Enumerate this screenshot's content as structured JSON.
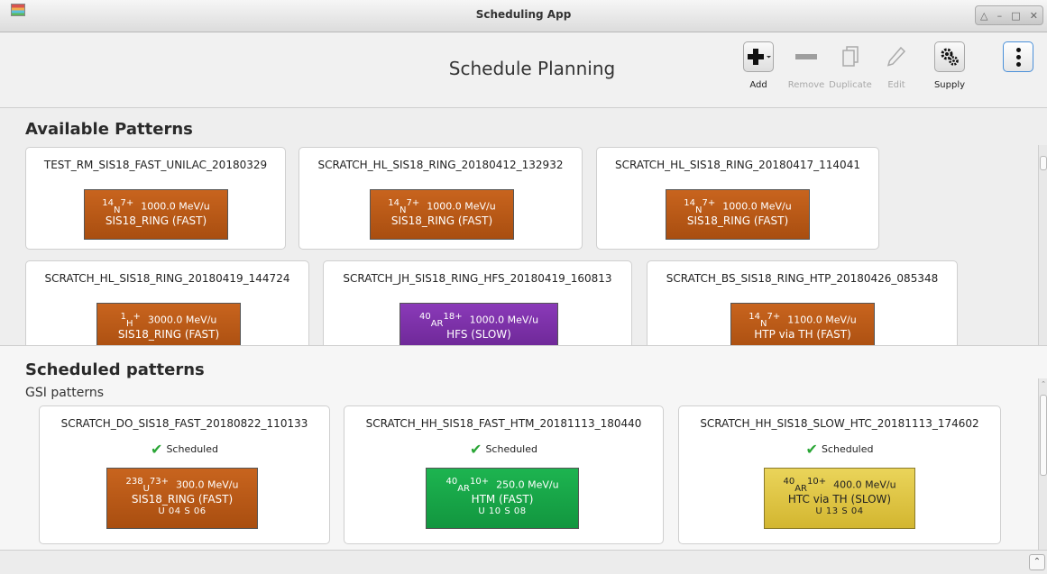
{
  "window": {
    "title": "Scheduling App"
  },
  "toolbar": {
    "page_title": "Schedule Planning",
    "buttons": [
      {
        "label": "Add",
        "icon": "plus-icon",
        "enabled": true
      },
      {
        "label": "Remove",
        "icon": "minus-icon",
        "enabled": false
      },
      {
        "label": "Duplicate",
        "icon": "duplicate-icon",
        "enabled": false
      },
      {
        "label": "Edit",
        "icon": "pencil-icon",
        "enabled": false
      },
      {
        "label": "Supply",
        "icon": "gears-icon",
        "enabled": true
      }
    ]
  },
  "available": {
    "title": "Available Patterns",
    "patterns": [
      {
        "name": "TEST_RM_SIS18_FAST_UNILAC_20180329",
        "mass": "14",
        "ion": "N",
        "charge": "7+",
        "energy": "1000.0 MeV/u",
        "target": "SIS18_RING (FAST)",
        "color": "#b85a18"
      },
      {
        "name": "SCRATCH_HL_SIS18_RING_20180412_132932",
        "mass": "14",
        "ion": "N",
        "charge": "7+",
        "energy": "1000.0 MeV/u",
        "target": "SIS18_RING (FAST)",
        "color": "#b85a18"
      },
      {
        "name": "SCRATCH_HL_SIS18_RING_20180417_114041",
        "mass": "14",
        "ion": "N",
        "charge": "7+",
        "energy": "1000.0 MeV/u",
        "target": "SIS18_RING (FAST)",
        "color": "#b85a18"
      },
      {
        "name": "SCRATCH_HL_SIS18_RING_20180419_144724",
        "mass": "1",
        "ion": "H",
        "charge": "+",
        "energy": "3000.0 MeV/u",
        "target": "SIS18_RING (FAST)",
        "color": "#b85a18"
      },
      {
        "name": "SCRATCH_JH_SIS18_RING_HFS_20180419_160813",
        "mass": "40",
        "ion": "AR",
        "charge": "18+",
        "energy": "1000.0 MeV/u",
        "target": "HFS (SLOW)",
        "color": "#7a2fa6"
      },
      {
        "name": "SCRATCH_BS_SIS18_RING_HTP_20180426_085348",
        "mass": "14",
        "ion": "N",
        "charge": "7+",
        "energy": "1100.0 MeV/u",
        "target": "HTP via TH (FAST)",
        "color": "#b85a18"
      }
    ]
  },
  "scheduled": {
    "title": "Scheduled patterns",
    "group": "GSI patterns",
    "status_label": "Scheduled",
    "patterns": [
      {
        "name": "SCRATCH_DO_SIS18_FAST_20180822_110133",
        "mass": "238",
        "ion": "U",
        "charge": "73+",
        "energy": "300.0 MeV/u",
        "target": "SIS18_RING (FAST)",
        "slots": "U 04   S 06",
        "color": "#b85a18"
      },
      {
        "name": "SCRATCH_HH_SIS18_FAST_HTM_20181113_180440",
        "mass": "40",
        "ion": "AR",
        "charge": "10+",
        "energy": "250.0 MeV/u",
        "target": "HTM (FAST)",
        "slots": "U 10   S 08",
        "color": "#16a548"
      },
      {
        "name": "SCRATCH_HH_SIS18_SLOW_HTC_20181113_174602",
        "mass": "40",
        "ion": "AR",
        "charge": "10+",
        "energy": "400.0 MeV/u",
        "target": "HTC via TH (SLOW)",
        "slots": "U 13   S 04",
        "color": "#e0c445"
      }
    ]
  }
}
